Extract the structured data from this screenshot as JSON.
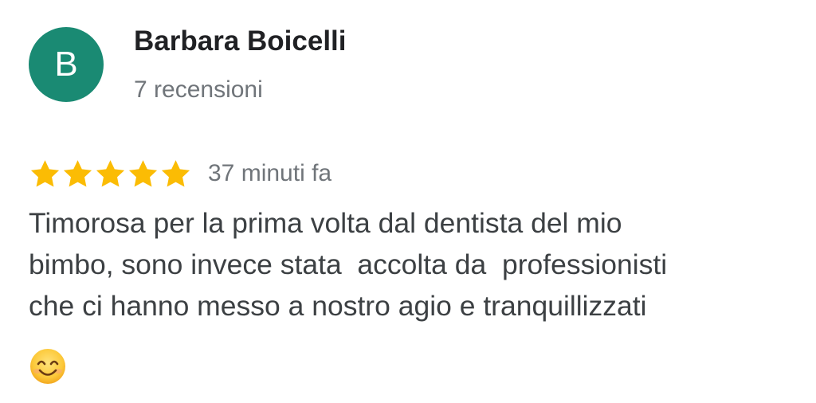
{
  "review": {
    "author": {
      "initial": "B",
      "name": "Barbara Boicelli",
      "reviews_count": "7 recensioni",
      "avatar_color": "#1a8a73"
    },
    "rating": 5,
    "star_color": "#fbbc04",
    "time_ago": "37 minuti fa",
    "text": "Timorosa per la prima volta dal dentista del mio\nbimbo, sono invece stata  accolta da  professionisti\nche ci hanno messo a nostro agio e tranquillizzati",
    "emoji_icon": "smiling-face-with-smiling-eyes-icon"
  }
}
